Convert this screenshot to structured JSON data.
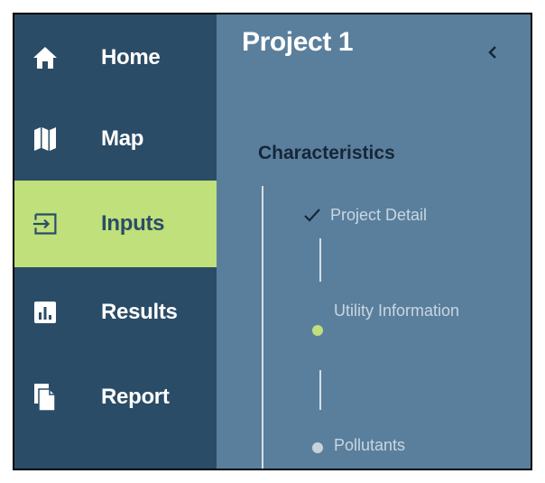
{
  "sidebar": {
    "items": [
      {
        "label": "Home",
        "icon": "home-icon",
        "active": false
      },
      {
        "label": "Map",
        "icon": "map-icon",
        "active": false
      },
      {
        "label": "Inputs",
        "icon": "input-icon",
        "active": true
      },
      {
        "label": "Results",
        "icon": "bar-chart-icon",
        "active": false
      },
      {
        "label": "Report",
        "icon": "document-icon",
        "active": false
      }
    ]
  },
  "main": {
    "title": "Project 1",
    "collapse_icon": "chevron-left-icon",
    "section_title": "Characteristics",
    "steps": [
      {
        "label": "Project Detail",
        "status": "completed",
        "icon": "checkmark-icon"
      },
      {
        "label": "Utility Information",
        "status": "current"
      },
      {
        "label": "Pollutants",
        "status": "upcoming"
      }
    ]
  },
  "colors": {
    "sidebar_bg": "#2b4c67",
    "main_bg": "#5a7f9c",
    "active_bg": "#bfe07a",
    "current_dot": "#bfe07a",
    "upcoming_dot": "#c9d2da",
    "step_text": "#c8d6e2"
  }
}
